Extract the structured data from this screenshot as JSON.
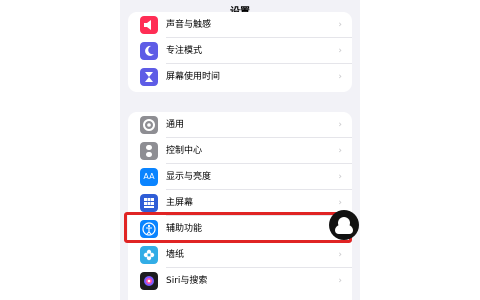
{
  "nav": {
    "title": "设置"
  },
  "group1": [
    {
      "label": "声音与触感",
      "icon": "speaker-icon",
      "color": "#ff2d55"
    },
    {
      "label": "专注模式",
      "icon": "moon-icon",
      "color": "#5e5ce6"
    },
    {
      "label": "屏幕使用时间",
      "icon": "hourglass-icon",
      "color": "#5e5ce6"
    }
  ],
  "group2": [
    {
      "label": "通用",
      "icon": "gear-icon",
      "color": "#8e8e93"
    },
    {
      "label": "控制中心",
      "icon": "control-center-icon",
      "color": "#8e8e93"
    },
    {
      "label": "显示与亮度",
      "icon": "aa-display-icon",
      "color": "#0a84ff",
      "glyph": "AA"
    },
    {
      "label": "主屏幕",
      "icon": "home-screen-grid-icon",
      "color": "#2f5dd6"
    },
    {
      "label": "辅助功能",
      "icon": "accessibility-icon",
      "color": "#0a84ff"
    },
    {
      "label": "墙纸",
      "icon": "wallpaper-flower-icon",
      "color": "#32ade6"
    },
    {
      "label": "Siri与搜索",
      "icon": "siri-icon",
      "color": "#1c1c1e"
    }
  ],
  "highlight": {
    "target": "辅助功能",
    "color": "#e02424"
  },
  "chevron": "›"
}
